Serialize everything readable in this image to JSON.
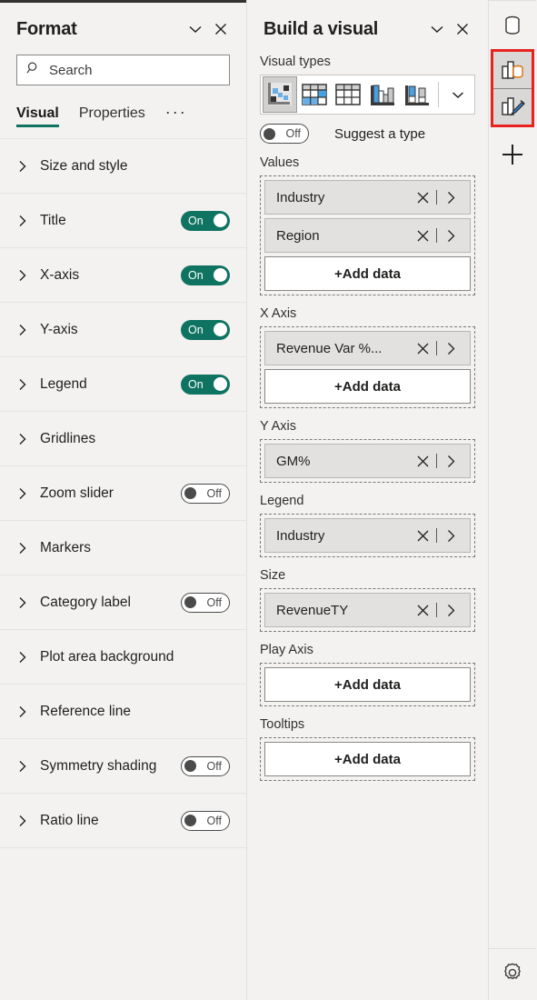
{
  "format_panel": {
    "title": "Format",
    "collapse_icon": "chevron-down-icon",
    "close_icon": "close-icon",
    "search": {
      "placeholder": "Search",
      "value": "",
      "icon": "search-icon"
    },
    "tabs": [
      {
        "label": "Visual",
        "active": true
      },
      {
        "label": "Properties",
        "active": false
      }
    ],
    "more_label": "···",
    "accent_color": "#0f7362",
    "rows": [
      {
        "label": "Size and style",
        "toggle": null
      },
      {
        "label": "Title",
        "toggle": "On"
      },
      {
        "label": "X-axis",
        "toggle": "On"
      },
      {
        "label": "Y-axis",
        "toggle": "On"
      },
      {
        "label": "Legend",
        "toggle": "On"
      },
      {
        "label": "Gridlines",
        "toggle": null
      },
      {
        "label": "Zoom slider",
        "toggle": "Off"
      },
      {
        "label": "Markers",
        "toggle": null
      },
      {
        "label": "Category label",
        "toggle": "Off"
      },
      {
        "label": "Plot area background",
        "toggle": null
      },
      {
        "label": "Reference line",
        "toggle": null
      },
      {
        "label": "Symmetry shading",
        "toggle": "Off"
      },
      {
        "label": "Ratio line",
        "toggle": "Off"
      }
    ]
  },
  "build_panel": {
    "title": "Build a visual",
    "collapse_icon": "chevron-down-icon",
    "close_icon": "close-icon",
    "visual_types_label": "Visual types",
    "visual_types": [
      {
        "name": "scatter-chart",
        "selected": true
      },
      {
        "name": "matrix",
        "selected": false
      },
      {
        "name": "table",
        "selected": false
      },
      {
        "name": "clustered-column-chart",
        "selected": false
      },
      {
        "name": "stacked-column-chart",
        "selected": false
      }
    ],
    "visual_types_expand_icon": "chevron-down-icon",
    "suggest": {
      "toggle": "Off",
      "label": "Suggest a type"
    },
    "wells": [
      {
        "label": "Values",
        "fields": [
          "Industry",
          "Region"
        ],
        "add_label": "+Add data"
      },
      {
        "label": "X Axis",
        "fields": [
          "Revenue Var %..."
        ],
        "add_label": "+Add data"
      },
      {
        "label": "Y Axis",
        "fields": [
          "GM%"
        ],
        "add_label": null
      },
      {
        "label": "Legend",
        "fields": [
          "Industry"
        ],
        "add_label": null
      },
      {
        "label": "Size",
        "fields": [
          "RevenueTY"
        ],
        "add_label": null
      },
      {
        "label": "Play Axis",
        "fields": [],
        "add_label": "+Add data"
      },
      {
        "label": "Tooltips",
        "fields": [],
        "add_label": "+Add data"
      }
    ],
    "chip_remove_icon": "close-icon",
    "chip_expand_icon": "chevron-right-icon"
  },
  "rail": {
    "highlight_color": "#e8231f",
    "items": [
      {
        "name": "data-icon",
        "selected": false,
        "highlighted": false
      },
      {
        "name": "build-visual-icon",
        "selected": true,
        "highlighted": true
      },
      {
        "name": "format-visual-icon",
        "selected": true,
        "highlighted": true
      },
      {
        "name": "add-icon",
        "selected": false,
        "highlighted": false
      }
    ],
    "bottom": {
      "name": "settings-gear-icon"
    }
  }
}
